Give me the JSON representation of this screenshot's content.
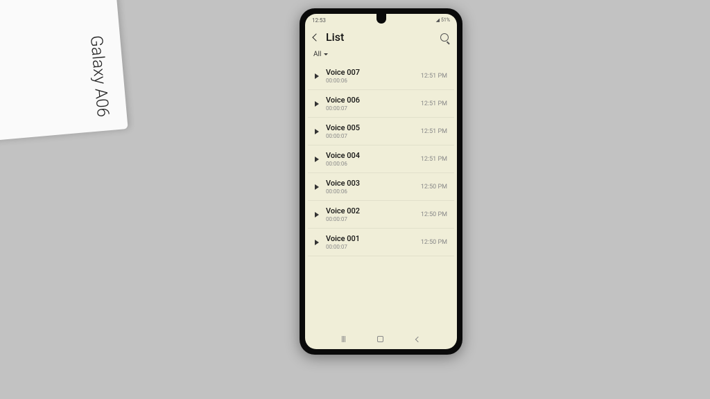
{
  "statusbar": {
    "time": "12:53",
    "battery": "51%"
  },
  "header": {
    "title": "List"
  },
  "filter": {
    "label": "All"
  },
  "recordings": [
    {
      "title": "Voice 007",
      "duration": "00:00:06",
      "time": "12:51 PM"
    },
    {
      "title": "Voice 006",
      "duration": "00:00:07",
      "time": "12:51 PM"
    },
    {
      "title": "Voice 005",
      "duration": "00:00:07",
      "time": "12:51 PM"
    },
    {
      "title": "Voice 004",
      "duration": "00:00:06",
      "time": "12:51 PM"
    },
    {
      "title": "Voice 003",
      "duration": "00:00:06",
      "time": "12:50 PM"
    },
    {
      "title": "Voice 002",
      "duration": "00:00:07",
      "time": "12:50 PM"
    },
    {
      "title": "Voice 001",
      "duration": "00:00:07",
      "time": "12:50 PM"
    }
  ],
  "context": {
    "box_label": "Galaxy A06"
  }
}
